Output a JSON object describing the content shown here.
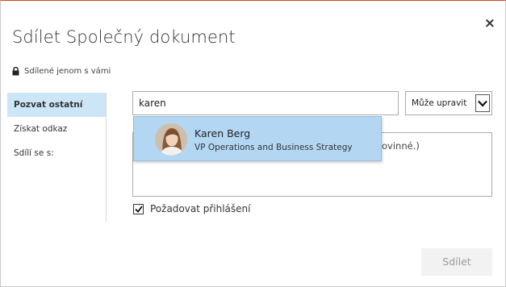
{
  "dialog": {
    "title": "Sdílet Společný dokument",
    "close_symbol": "×",
    "shared_note": "Sdílené jenom s vámi"
  },
  "nav": {
    "items": [
      {
        "label": "Pozvat ostatní",
        "active": true
      },
      {
        "label": "Získat odkaz",
        "active": false
      },
      {
        "label": "Sdílí se s:",
        "active": false
      }
    ]
  },
  "invite": {
    "input_value": "karen",
    "permission": "Může upravit",
    "message_partial_visible": "ovinné.)"
  },
  "suggestion": {
    "name": "Karen Berg",
    "title": "VP Operations and Business Strategy"
  },
  "require_signin": {
    "label": "Požadovat přihlášení",
    "checked": true
  },
  "actions": {
    "share_label": "Sdílet"
  },
  "icons": {
    "lock": "lock-icon",
    "close": "close-icon",
    "dropdown": "chevron-down-icon",
    "check": "check-icon"
  },
  "colors": {
    "accent_border": "#d24726",
    "active_nav_bg": "#cde6f7",
    "suggestion_bg": "#b3d7f3"
  }
}
